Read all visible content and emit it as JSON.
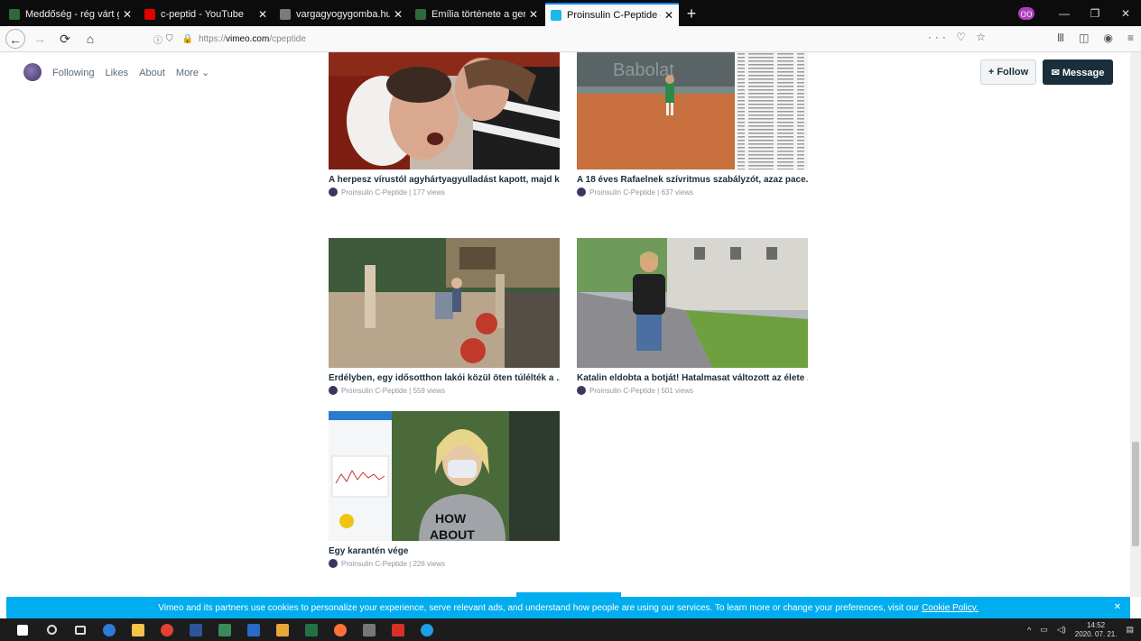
{
  "browser": {
    "tabs": [
      {
        "title": "Meddőség - rég várt gyermek",
        "favicon_color": "#2f6b3a",
        "active": false
      },
      {
        "title": "c-peptid - YouTube",
        "favicon_color": "#e00000",
        "active": false
      },
      {
        "title": "vargagyogygomba.hu/hu/film",
        "favicon_color": "#7a7a7a",
        "active": false
      },
      {
        "title": "Emília története a gerincferdül",
        "favicon_color": "#2f6b3a",
        "active": false
      },
      {
        "title": "Proinsulin C-Peptide on Vimeo",
        "favicon_color": "#1ab7ea",
        "active": true
      }
    ],
    "url_prefix": "https://",
    "url_domain": "vimeo.com",
    "url_path": "/cpeptide"
  },
  "vimeo": {
    "nav": [
      "Following",
      "Likes",
      "About",
      "More ⌄"
    ],
    "follow_label": "+ Follow",
    "message_label": "✉ Message"
  },
  "videos": [
    {
      "title": "A herpesz vírustól agyhártyagyulladást kapott, majd k...",
      "channel": "Proinsulin C-Peptide",
      "views": "177 views"
    },
    {
      "title": "A 18 éves Rafaelnek szívritmus szabályzót, azaz pace...",
      "channel": "Proinsulin C-Peptide",
      "views": "637 views"
    },
    {
      "title": "Erdélyben, egy idősotthon lakói közül öten túlélték a ...",
      "channel": "Proinsulin C-Peptide",
      "views": "559 views"
    },
    {
      "title": "Katalin eldobta a botját! Hatalmasat változott az élete ...",
      "channel": "Proinsulin C-Peptide",
      "views": "501 views"
    },
    {
      "title": "Egy karantén vége",
      "channel": "Proinsulin C-Peptide",
      "views": "226 views"
    }
  ],
  "cookie": {
    "text": "Vimeo and its partners use cookies to personalize your experience, serve relevant ads, and understand how people are using our services. To learn more or change your preferences, visit our",
    "link": "Cookie Policy."
  },
  "taskbar": {
    "time": "14:52",
    "date": "2020. 07. 21."
  }
}
